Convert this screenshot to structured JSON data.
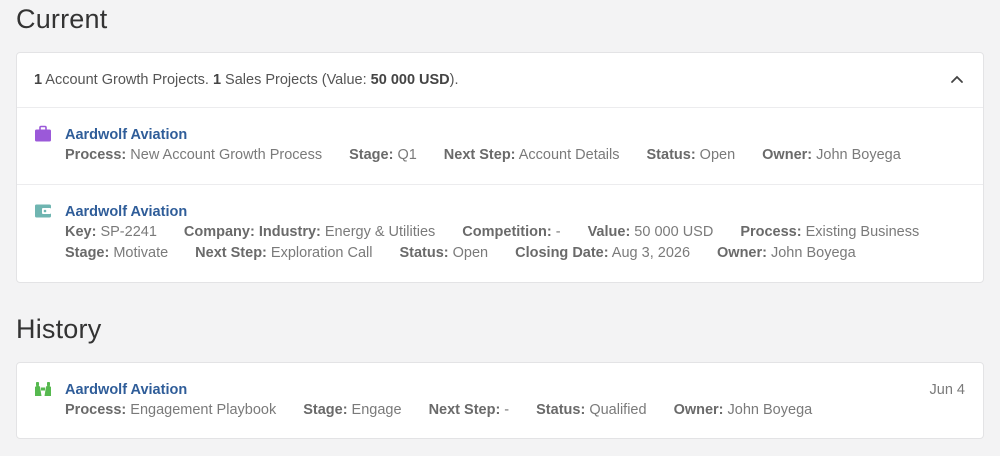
{
  "current": {
    "title": "Current",
    "summary": {
      "ag_count": "1",
      "ag_text": " Account Growth Projects. ",
      "sp_count": "1",
      "sp_text": " Sales Projects (Value: ",
      "sp_value": "50 000 USD",
      "sp_end": ")."
    },
    "items": [
      {
        "icon": "briefcase-icon",
        "title": "Aardwolf Aviation",
        "lines": [
          [
            {
              "k": "Process:",
              "v": " New Account Growth Process"
            },
            {
              "k": "Stage:",
              "v": " Q1"
            },
            {
              "k": "Next Step:",
              "v": " Account Details"
            },
            {
              "k": "Status:",
              "v": " Open"
            },
            {
              "k": "Owner:",
              "v": " John Boyega"
            }
          ]
        ]
      },
      {
        "icon": "wallet-icon",
        "title": "Aardwolf Aviation",
        "lines": [
          [
            {
              "k": "Key:",
              "v": " SP-2241"
            },
            {
              "k": "Company: Industry:",
              "v": " Energy & Utilities"
            },
            {
              "k": "Competition:",
              "v": " -"
            },
            {
              "k": "Value:",
              "v": " 50 000 USD"
            },
            {
              "k": "Process:",
              "v": " Existing Business"
            }
          ],
          [
            {
              "k": "Stage:",
              "v": " Motivate"
            },
            {
              "k": "Next Step:",
              "v": " Exploration Call"
            },
            {
              "k": "Status:",
              "v": " Open"
            },
            {
              "k": "Closing Date:",
              "v": " Aug 3, 2026"
            },
            {
              "k": "Owner:",
              "v": " John Boyega"
            }
          ]
        ]
      }
    ]
  },
  "history": {
    "title": "History",
    "items": [
      {
        "icon": "binoculars-icon",
        "title": "Aardwolf Aviation",
        "date": "Jun 4",
        "lines": [
          [
            {
              "k": "Process:",
              "v": " Engagement Playbook"
            },
            {
              "k": "Stage:",
              "v": " Engage"
            },
            {
              "k": "Next Step:",
              "v": " -"
            },
            {
              "k": "Status:",
              "v": " Qualified"
            },
            {
              "k": "Owner:",
              "v": " John Boyega"
            }
          ]
        ]
      }
    ]
  },
  "colors": {
    "briefcase": "#9b59d9",
    "wallet": "#6fb5b1",
    "binoculars": "#56b94f",
    "link": "#2f5d99"
  }
}
